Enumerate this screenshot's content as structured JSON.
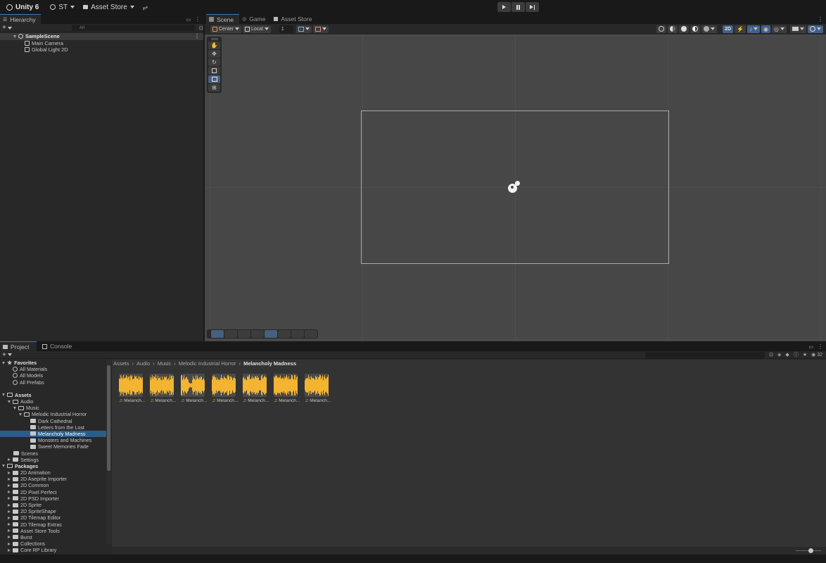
{
  "topbar": {
    "app_name": "Unity 6",
    "account": "ST",
    "asset_store": "Asset Store"
  },
  "hierarchy": {
    "tab": "Hierarchy",
    "search_placeholder": "All",
    "scene": "SampleScene",
    "objects": [
      "Main Camera",
      "Global Light 2D"
    ]
  },
  "scene_tabs": [
    {
      "label": "Scene",
      "active": true
    },
    {
      "label": "Game",
      "active": false
    },
    {
      "label": "Asset Store",
      "active": false
    }
  ],
  "scene_toolbar": {
    "pivot": "Center",
    "space": "Local",
    "grid_snap": "1",
    "mode_2d": "2D"
  },
  "bottom_tabs": [
    {
      "label": "Project",
      "active": true
    },
    {
      "label": "Console",
      "active": false
    }
  ],
  "project": {
    "favorites_label": "Favorites",
    "favorites": [
      "All Materials",
      "All Models",
      "All Prefabs"
    ],
    "assets_label": "Assets",
    "tree": [
      {
        "label": "Audio",
        "indent": 1,
        "arrow": "down",
        "open": true
      },
      {
        "label": "Music",
        "indent": 2,
        "arrow": "down",
        "open": true
      },
      {
        "label": "Melodic Industrial Horror",
        "indent": 3,
        "arrow": "down",
        "open": true
      },
      {
        "label": "Dark Cathedral",
        "indent": 4,
        "arrow": "none"
      },
      {
        "label": "Letters from the Lost",
        "indent": 4,
        "arrow": "none"
      },
      {
        "label": "Melancholy Madness",
        "indent": 4,
        "arrow": "none",
        "selected": true
      },
      {
        "label": "Monsters and Machines",
        "indent": 4,
        "arrow": "none"
      },
      {
        "label": "Sweet Memories Fade",
        "indent": 4,
        "arrow": "none"
      },
      {
        "label": "Scenes",
        "indent": 1,
        "arrow": "none"
      },
      {
        "label": "Settings",
        "indent": 1,
        "arrow": "right"
      }
    ],
    "packages_label": "Packages",
    "packages": [
      "2D Animation",
      "2D Aseprite Importer",
      "2D Common",
      "2D Pixel Perfect",
      "2D PSD Importer",
      "2D Sprite",
      "2D SpriteShape",
      "2D Tilemap Editor",
      "2D Tilemap Extras",
      "Asset Store Tools",
      "Burst",
      "Collections",
      "Core RP Library"
    ],
    "breadcrumb": [
      "Assets",
      "Audio",
      "Music",
      "Melodic Industrial Horror"
    ],
    "breadcrumb_current": "Melancholy Madness",
    "assets": [
      "Melanch...",
      "Melanch...",
      "Melanch...",
      "Melanch...",
      "Melanch...",
      "Melanch...",
      "Melanch..."
    ],
    "count_badge": "32"
  },
  "colors": {
    "accent": "#3a79bb",
    "selection": "#2c5d87",
    "waveform": "#f2b431"
  }
}
